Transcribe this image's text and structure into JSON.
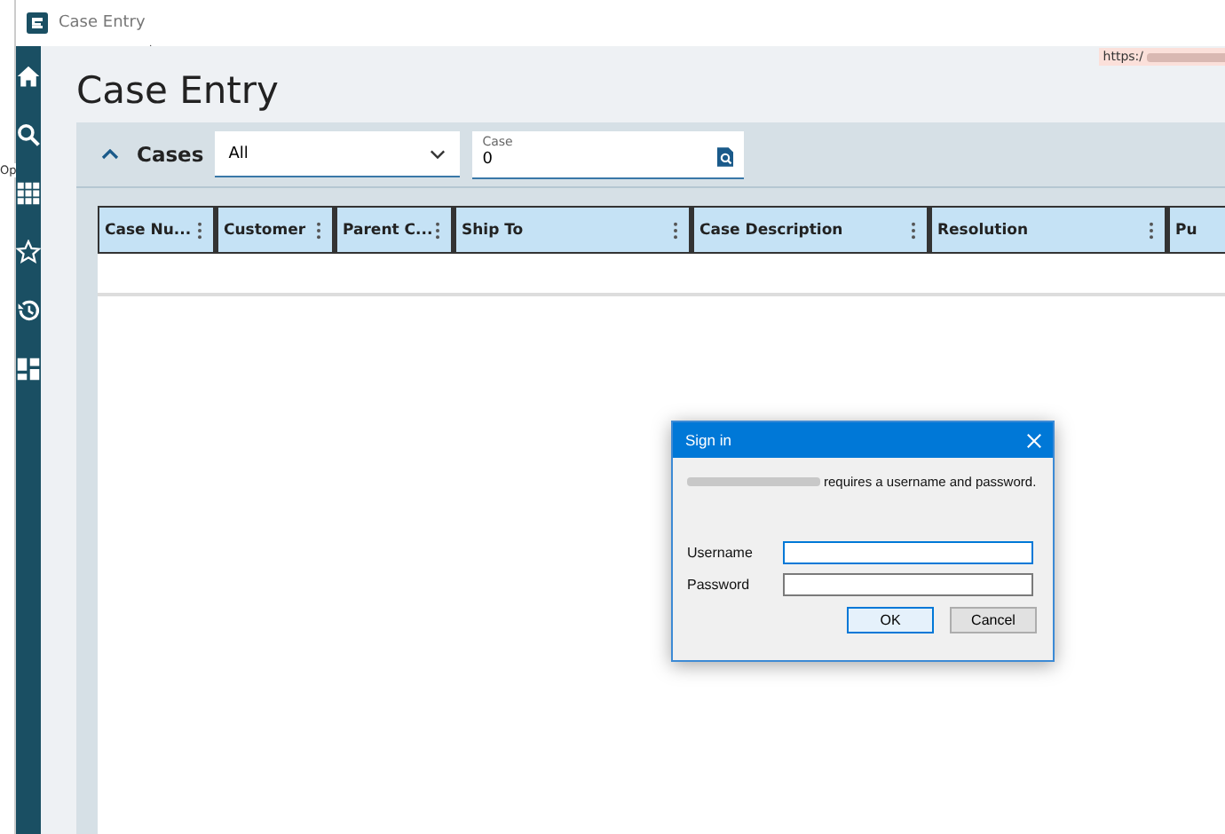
{
  "background_window": {
    "text": "Op"
  },
  "window": {
    "title": "Case Entry",
    "url": "https:/"
  },
  "sidebar": {
    "items": [
      {
        "kind": "home"
      },
      {
        "kind": "search"
      },
      {
        "kind": "apps"
      },
      {
        "kind": "star"
      },
      {
        "kind": "history"
      },
      {
        "kind": "dashboard"
      }
    ]
  },
  "page": {
    "title": "Case Entry"
  },
  "panel": {
    "title": "Cases",
    "expanded": true,
    "filter": {
      "value": "All"
    },
    "case_field": {
      "label": "Case",
      "value": "0"
    }
  },
  "table": {
    "columns": [
      {
        "label": "Case Nu...",
        "menu": true
      },
      {
        "label": "Customer",
        "menu": true
      },
      {
        "label": "Parent C...",
        "menu": true
      },
      {
        "label": "Ship To",
        "menu": true
      },
      {
        "label": "Case Description",
        "menu": true
      },
      {
        "label": "Resolution",
        "menu": true
      },
      {
        "label": "Pu",
        "menu": false
      }
    ]
  },
  "dialog": {
    "title": "Sign in",
    "message": "requires a username and password.",
    "fields": [
      {
        "label": "Username",
        "focused": true
      },
      {
        "label": "Password",
        "focused": false
      }
    ],
    "buttons": [
      {
        "label": "OK",
        "default": true
      },
      {
        "label": "Cancel",
        "default": false
      }
    ]
  }
}
